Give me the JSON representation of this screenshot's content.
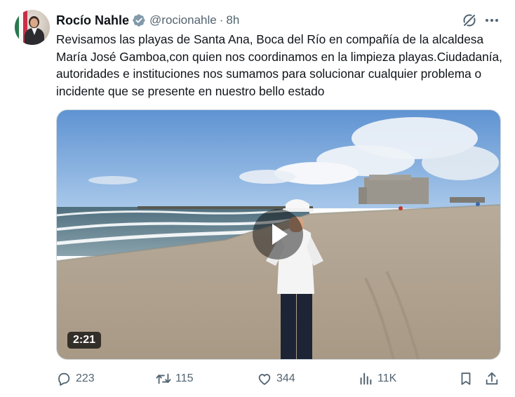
{
  "author": {
    "name": "Rocío Nahle",
    "handle": "@rocionahle",
    "separator": "·",
    "time": "8h",
    "avatar_icon": "profile-photo"
  },
  "post": {
    "text": "Revisamos las playas de Santa Ana, Boca del Río en compañía de la alcaldesa María José Gamboa,con quien nos coordinamos en la limpieza playas.Ciudadanía, autoridades e instituciones nos sumamos para solucionar cualquier problema o incidente que se presente en nuestro bello estado"
  },
  "media": {
    "type": "video",
    "duration": "2:21"
  },
  "actions": {
    "replies": "223",
    "reposts": "115",
    "likes": "344",
    "views": "11K"
  },
  "colors": {
    "text": "#0f1419",
    "secondary": "#536471",
    "verified": "#829aab"
  }
}
